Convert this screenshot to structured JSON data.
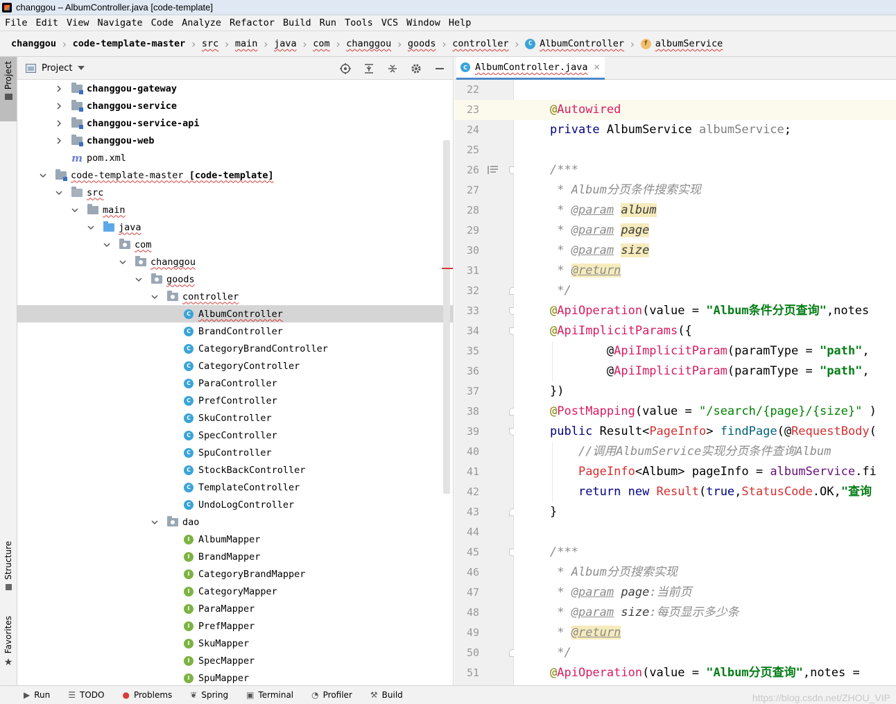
{
  "window": {
    "title": "changgou – AlbumController.java [code-template]"
  },
  "menu": [
    "File",
    "Edit",
    "View",
    "Navigate",
    "Code",
    "Analyze",
    "Refactor",
    "Build",
    "Run",
    "Tools",
    "VCS",
    "Window",
    "Help"
  ],
  "breadcrumb": {
    "items": [
      "changgou",
      "code-template-master",
      "src",
      "main",
      "java",
      "com",
      "changgou",
      "goods",
      "controller",
      "AlbumController",
      "albumService"
    ],
    "class_icon": "C",
    "field_icon": "f"
  },
  "left_stripe": {
    "project": "Project",
    "structure": "Structure",
    "favorites": "Favorites"
  },
  "project_panel": {
    "title": "Project",
    "tools": [
      "locate-icon",
      "expand-all-icon",
      "collapse-all-icon",
      "gear-icon",
      "minimize-icon"
    ],
    "tree": [
      {
        "label": "changgou-gateway",
        "depth": 0,
        "icon": "module",
        "arrow": "right",
        "bold": true
      },
      {
        "label": "changgou-service",
        "depth": 0,
        "icon": "module",
        "arrow": "right",
        "bold": true
      },
      {
        "label": "changgou-service-api",
        "depth": 0,
        "icon": "module",
        "arrow": "right",
        "bold": true
      },
      {
        "label": "changgou-web",
        "depth": 0,
        "icon": "module",
        "arrow": "right",
        "bold": true
      },
      {
        "label": "pom.xml",
        "depth": 0,
        "icon": "maven",
        "arrow": "none"
      },
      {
        "label": "code-template-master",
        "suffix": " [code-template]",
        "depth": -1,
        "icon": "module",
        "arrow": "down",
        "squig": true
      },
      {
        "label": "src",
        "depth": 0,
        "icon": "src",
        "arrow": "down",
        "squig": true
      },
      {
        "label": "main",
        "depth": 1,
        "icon": "folder",
        "arrow": "down",
        "squig": true
      },
      {
        "label": "java",
        "depth": 2,
        "icon": "java",
        "arrow": "down",
        "squig": true
      },
      {
        "label": "com",
        "depth": 3,
        "icon": "pkg",
        "arrow": "down",
        "squig": true
      },
      {
        "label": "changgou",
        "depth": 4,
        "icon": "pkg",
        "arrow": "down",
        "squig": true
      },
      {
        "label": "goods",
        "depth": 5,
        "icon": "pkg",
        "arrow": "down",
        "squig": true
      },
      {
        "label": "controller",
        "depth": 6,
        "icon": "pkg",
        "arrow": "down",
        "squig": true
      },
      {
        "label": "AlbumController",
        "depth": 7,
        "icon": "class",
        "arrow": "none",
        "squig": true,
        "selected": true
      },
      {
        "label": "BrandController",
        "depth": 7,
        "icon": "class",
        "arrow": "none"
      },
      {
        "label": "CategoryBrandController",
        "depth": 7,
        "icon": "class",
        "arrow": "none"
      },
      {
        "label": "CategoryController",
        "depth": 7,
        "icon": "class",
        "arrow": "none"
      },
      {
        "label": "ParaController",
        "depth": 7,
        "icon": "class",
        "arrow": "none"
      },
      {
        "label": "PrefController",
        "depth": 7,
        "icon": "class",
        "arrow": "none"
      },
      {
        "label": "SkuController",
        "depth": 7,
        "icon": "class",
        "arrow": "none"
      },
      {
        "label": "SpecController",
        "depth": 7,
        "icon": "class",
        "arrow": "none"
      },
      {
        "label": "SpuController",
        "depth": 7,
        "icon": "class",
        "arrow": "none"
      },
      {
        "label": "StockBackController",
        "depth": 7,
        "icon": "class",
        "arrow": "none"
      },
      {
        "label": "TemplateController",
        "depth": 7,
        "icon": "class",
        "arrow": "none"
      },
      {
        "label": "UndoLogController",
        "depth": 7,
        "icon": "class",
        "arrow": "none"
      },
      {
        "label": "dao",
        "depth": 6,
        "icon": "pkg",
        "arrow": "down"
      },
      {
        "label": "AlbumMapper",
        "depth": 7,
        "icon": "iface",
        "arrow": "none"
      },
      {
        "label": "BrandMapper",
        "depth": 7,
        "icon": "iface",
        "arrow": "none"
      },
      {
        "label": "CategoryBrandMapper",
        "depth": 7,
        "icon": "iface",
        "arrow": "none"
      },
      {
        "label": "CategoryMapper",
        "depth": 7,
        "icon": "iface",
        "arrow": "none"
      },
      {
        "label": "ParaMapper",
        "depth": 7,
        "icon": "iface",
        "arrow": "none"
      },
      {
        "label": "PrefMapper",
        "depth": 7,
        "icon": "iface",
        "arrow": "none"
      },
      {
        "label": "SkuMapper",
        "depth": 7,
        "icon": "iface",
        "arrow": "none"
      },
      {
        "label": "SpecMapper",
        "depth": 7,
        "icon": "iface",
        "arrow": "none"
      },
      {
        "label": "SpuMapper",
        "depth": 7,
        "icon": "iface",
        "arrow": "none"
      }
    ]
  },
  "editor": {
    "tab_label": "AlbumController.java",
    "tab_icon": "C",
    "current_line": 23,
    "lines": [
      {
        "n": 22,
        "tokens": []
      },
      {
        "n": 23,
        "tokens": [
          [
            "ann",
            "@"
          ],
          [
            "annr",
            "Autowired"
          ]
        ],
        "gutter": "error"
      },
      {
        "n": 24,
        "tokens": [
          [
            "kw",
            "private "
          ],
          [
            "",
            "AlbumService "
          ],
          [
            "gray",
            "albumService"
          ],
          [
            "",
            ";"
          ]
        ]
      },
      {
        "n": 25,
        "tokens": []
      },
      {
        "n": 26,
        "tokens": [
          [
            "doc",
            "/***"
          ]
        ],
        "gutter": "doclist",
        "fold": "down"
      },
      {
        "n": 27,
        "tokens": [
          [
            "doc",
            " * Album分页条件搜索实现"
          ]
        ]
      },
      {
        "n": 28,
        "tokens": [
          [
            "doc",
            " * "
          ],
          [
            "tag",
            "@param"
          ],
          [
            "doc",
            " "
          ],
          [
            "param_hl",
            "album"
          ]
        ]
      },
      {
        "n": 29,
        "tokens": [
          [
            "doc",
            " * "
          ],
          [
            "tag",
            "@param"
          ],
          [
            "doc",
            " "
          ],
          [
            "param_hl",
            "page"
          ]
        ]
      },
      {
        "n": 30,
        "tokens": [
          [
            "doc",
            " * "
          ],
          [
            "tag",
            "@param"
          ],
          [
            "doc",
            " "
          ],
          [
            "param_hl",
            "size"
          ]
        ]
      },
      {
        "n": 31,
        "tokens": [
          [
            "doc",
            " * "
          ],
          [
            "tag_hl",
            "@return"
          ]
        ]
      },
      {
        "n": 32,
        "tokens": [
          [
            "doc",
            " */"
          ]
        ],
        "fold": "up"
      },
      {
        "n": 33,
        "tokens": [
          [
            "ann",
            "@"
          ],
          [
            "annr",
            "ApiOperation"
          ],
          [
            "",
            "(value = "
          ],
          [
            "str",
            "\"Album条件分页查询\""
          ],
          [
            "",
            ",notes"
          ]
        ],
        "fold": "down"
      },
      {
        "n": 34,
        "tokens": [
          [
            "ann",
            "@"
          ],
          [
            "annr",
            "ApiImplicitParams"
          ],
          [
            "",
            "({"
          ]
        ],
        "fold": "down"
      },
      {
        "n": 35,
        "tokens": [
          [
            "",
            "        @"
          ],
          [
            "annr",
            "ApiImplicitParam"
          ],
          [
            "",
            "(paramType = "
          ],
          [
            "str",
            "\"path\""
          ],
          [
            "",
            ","
          ]
        ]
      },
      {
        "n": 36,
        "tokens": [
          [
            "",
            "        @"
          ],
          [
            "annr",
            "ApiImplicitParam"
          ],
          [
            "",
            "(paramType = "
          ],
          [
            "str",
            "\"path\""
          ],
          [
            "",
            ","
          ]
        ]
      },
      {
        "n": 37,
        "tokens": [
          [
            "",
            "})"
          ]
        ]
      },
      {
        "n": 38,
        "tokens": [
          [
            "ann",
            "@"
          ],
          [
            "annr",
            "PostMapping"
          ],
          [
            "",
            "(value = "
          ],
          [
            "str2",
            "\"/search/{page}/{size}\""
          ],
          [
            "",
            " )"
          ]
        ],
        "fold": "up"
      },
      {
        "n": 39,
        "tokens": [
          [
            "kw",
            "public "
          ],
          [
            "",
            "Result<"
          ],
          [
            "type",
            "PageInfo"
          ],
          [
            "",
            "> "
          ],
          [
            "method",
            "findPage"
          ],
          [
            "",
            "(@"
          ],
          [
            "type",
            "RequestBody"
          ],
          [
            "",
            "("
          ]
        ],
        "fold": "down"
      },
      {
        "n": 40,
        "tokens": [
          [
            "cmt",
            "    //调用AlbumService实现分页条件查询Album"
          ]
        ]
      },
      {
        "n": 41,
        "tokens": [
          [
            "",
            "    "
          ],
          [
            "type",
            "PageInfo"
          ],
          [
            "",
            "<Album> pageInfo = "
          ],
          [
            "field",
            "albumService"
          ],
          [
            "",
            ".fi"
          ]
        ]
      },
      {
        "n": 42,
        "tokens": [
          [
            "",
            "    "
          ],
          [
            "kw",
            "return new "
          ],
          [
            "type",
            "Result"
          ],
          [
            "",
            "("
          ],
          [
            "kw",
            "true"
          ],
          [
            "",
            ","
          ],
          [
            "type",
            "StatusCode"
          ],
          [
            "",
            ".OK,"
          ],
          [
            "str",
            "\"查询"
          ]
        ]
      },
      {
        "n": 43,
        "tokens": [
          [
            "",
            "}"
          ]
        ],
        "fold": "up"
      },
      {
        "n": 44,
        "tokens": []
      },
      {
        "n": 45,
        "tokens": [
          [
            "doc",
            "/***"
          ]
        ],
        "fold": "down"
      },
      {
        "n": 46,
        "tokens": [
          [
            "doc",
            " * Album分页搜索实现"
          ]
        ]
      },
      {
        "n": 47,
        "tokens": [
          [
            "doc",
            " * "
          ],
          [
            "tag",
            "@param"
          ],
          [
            "doc",
            " "
          ],
          [
            "param",
            "page"
          ],
          [
            "doc",
            ":当前页"
          ]
        ]
      },
      {
        "n": 48,
        "tokens": [
          [
            "doc",
            " * "
          ],
          [
            "tag",
            "@param"
          ],
          [
            "doc",
            " "
          ],
          [
            "param",
            "size"
          ],
          [
            "doc",
            ":每页显示多少条"
          ]
        ]
      },
      {
        "n": 49,
        "tokens": [
          [
            "doc",
            " * "
          ],
          [
            "tag_hl",
            "@return"
          ]
        ]
      },
      {
        "n": 50,
        "tokens": [
          [
            "doc",
            " */"
          ]
        ],
        "fold": "up"
      },
      {
        "n": 51,
        "tokens": [
          [
            "ann",
            "@"
          ],
          [
            "annr",
            "ApiOperation"
          ],
          [
            "",
            "(value = "
          ],
          [
            "str",
            "\"Album分页查询\""
          ],
          [
            "",
            ",notes = "
          ]
        ]
      }
    ]
  },
  "bottom_bar": [
    {
      "label": "Run",
      "icon": "▶"
    },
    {
      "label": "TODO",
      "icon": "☰"
    },
    {
      "label": "Problems",
      "icon": "●",
      "red": true
    },
    {
      "label": "Spring",
      "icon": "❦"
    },
    {
      "label": "Terminal",
      "icon": "▣"
    },
    {
      "label": "Profiler",
      "icon": "◔"
    },
    {
      "label": "Build",
      "icon": "⚒"
    }
  ],
  "watermark": "https://blog.csdn.net/ZHOU_VIP"
}
